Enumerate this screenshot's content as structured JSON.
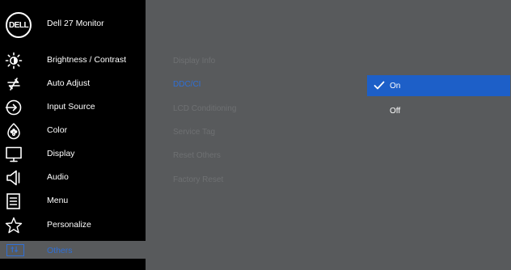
{
  "header": {
    "logo_text": "DELL",
    "monitor_name": "Dell 27 Monitor"
  },
  "sidebar": {
    "items": [
      {
        "label": "Brightness / Contrast",
        "icon": "brightness-icon"
      },
      {
        "label": "Auto Adjust",
        "icon": "auto-adjust-icon"
      },
      {
        "label": "Input Source",
        "icon": "input-source-icon"
      },
      {
        "label": "Color",
        "icon": "color-icon"
      },
      {
        "label": "Display",
        "icon": "display-icon"
      },
      {
        "label": "Audio",
        "icon": "audio-icon"
      },
      {
        "label": "Menu",
        "icon": "menu-icon"
      },
      {
        "label": "Personalize",
        "icon": "star-icon"
      },
      {
        "label": "Others",
        "icon": "others-icon",
        "active": true
      }
    ]
  },
  "submenu": {
    "items": [
      {
        "label": "Display Info"
      },
      {
        "label": "DDC/CI",
        "selected": true
      },
      {
        "label": "LCD Conditioning"
      },
      {
        "label": "Service Tag"
      },
      {
        "label": "Reset Others"
      },
      {
        "label": "Factory Reset"
      }
    ]
  },
  "options": {
    "items": [
      {
        "label": "On",
        "selected": true
      },
      {
        "label": "Off"
      }
    ]
  },
  "colors": {
    "sidebar_bg": "#000000",
    "panel_bg": "#585a5c",
    "accent": "#2f6fd6",
    "selected_option_bg": "#1d5fc8"
  }
}
